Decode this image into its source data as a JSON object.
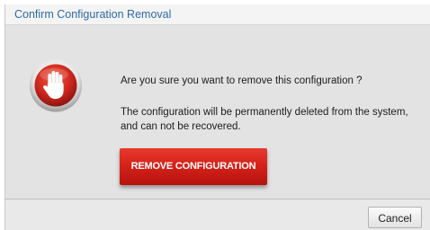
{
  "dialog": {
    "title": "Confirm Configuration Removal",
    "icon": "stop-hand-icon",
    "question": "Are you sure you want to remove this configuration ?",
    "warning": "The configuration will be permanently deleted from the system, and can not be recovered.",
    "primary_button": "REMOVE CONFIGURATION",
    "cancel_button": "Cancel"
  },
  "colors": {
    "title_text": "#2d6aa3",
    "primary_button": "#d5231a",
    "icon_red": "#d0291f",
    "dialog_bg": "#e3e3e3"
  }
}
